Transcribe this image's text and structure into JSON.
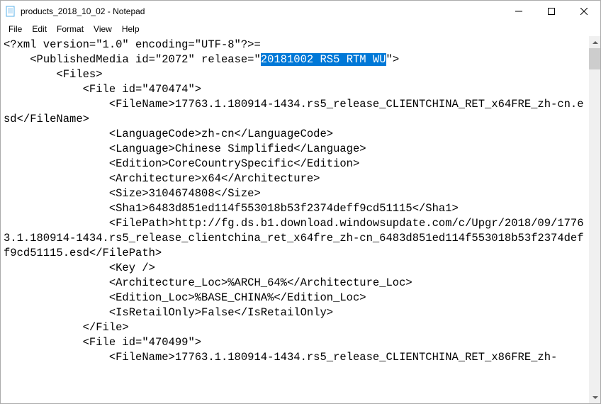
{
  "window": {
    "title": "products_2018_10_02 - Notepad"
  },
  "menu": {
    "file": "File",
    "edit": "Edit",
    "format": "Format",
    "view": "View",
    "help": "Help"
  },
  "content": {
    "pre": "<?xml version=\"1.0\" encoding=\"UTF-8\"?>=\n    <PublishedMedia id=\"2072\" release=\"",
    "highlight": "20181002 RS5 RTM WU",
    "post": "\">\n        <Files>\n            <File id=\"470474\">\n                <FileName>17763.1.180914-1434.rs5_release_CLIENTCHINA_RET_x64FRE_zh-cn.esd</FileName>\n                <LanguageCode>zh-cn</LanguageCode>\n                <Language>Chinese Simplified</Language>\n                <Edition>CoreCountrySpecific</Edition>\n                <Architecture>x64</Architecture>\n                <Size>3104674808</Size>\n                <Sha1>6483d851ed114f553018b53f2374deff9cd51115</Sha1>\n                <FilePath>http://fg.ds.b1.download.windowsupdate.com/c/Upgr/2018/09/17763.1.180914-1434.rs5_release_clientchina_ret_x64fre_zh-cn_6483d851ed114f553018b53f2374deff9cd51115.esd</FilePath>\n                <Key />\n                <Architecture_Loc>%ARCH_64%</Architecture_Loc>\n                <Edition_Loc>%BASE_CHINA%</Edition_Loc>\n                <IsRetailOnly>False</IsRetailOnly>\n            </File>\n            <File id=\"470499\">\n                <FileName>17763.1.180914-1434.rs5_release_CLIENTCHINA_RET_x86FRE_zh-"
  }
}
